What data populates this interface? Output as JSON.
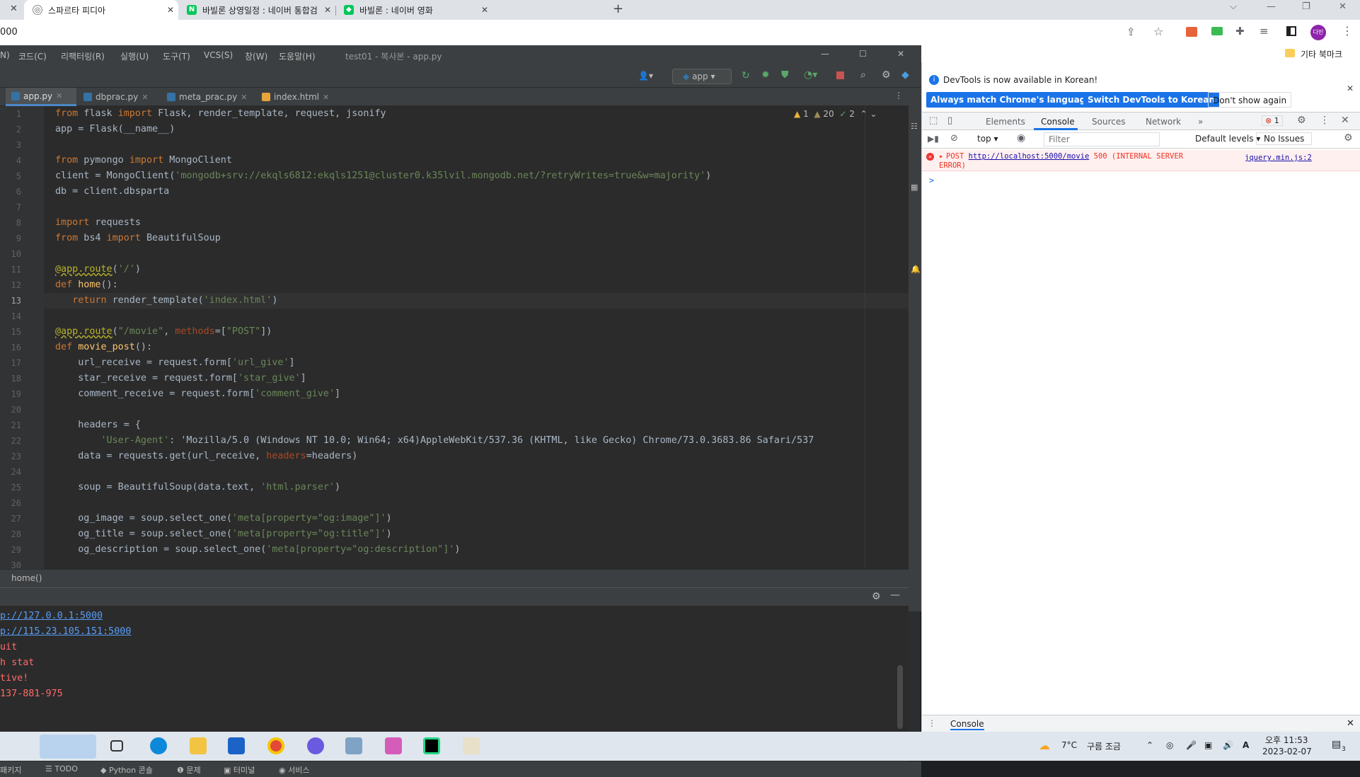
{
  "browser": {
    "tabs": [
      {
        "label": "스파르타 피디아",
        "active": true
      },
      {
        "label": "바빌론 상영일정 : 네이버 통합검",
        "active": false
      },
      {
        "label": "바빌론 : 네이버 영화",
        "active": false
      }
    ],
    "address": "000",
    "bookmarks_other": "기타 북마크",
    "profile": "다빈"
  },
  "ide": {
    "menus": [
      "N)",
      "코드(C)",
      "리팩터링(R)",
      "실행(U)",
      "도구(T)",
      "VCS(S)",
      "창(W)",
      "도움말(H)"
    ],
    "window_title": "test01 - 복사본 - app.py",
    "run_config": "app",
    "tabs": [
      {
        "label": "app.py",
        "active": true
      },
      {
        "label": "dbprac.py",
        "active": false
      },
      {
        "label": "meta_prac.py",
        "active": false
      },
      {
        "label": "index.html",
        "active": false
      }
    ],
    "inspections": {
      "warn_a": "1",
      "warn_b": "20",
      "ok": "2"
    },
    "current_line": 13,
    "line_numbers": [
      "1",
      "2",
      "3",
      "4",
      "5",
      "6",
      "7",
      "8",
      "9",
      "10",
      "11",
      "12",
      "13",
      "14",
      "15",
      "16",
      "17",
      "18",
      "19",
      "20",
      "21",
      "22",
      "23",
      "24",
      "25",
      "26",
      "27",
      "28",
      "29",
      "30"
    ],
    "code_lines": [
      "from flask import Flask, render_template, request, jsonify",
      "app = Flask(__name__)",
      "",
      "from pymongo import MongoClient",
      "client = MongoClient('mongodb+srv://ekqls6812:ekqls1251@cluster0.k35lvil.mongodb.net/?retryWrites=true&w=majority')",
      "db = client.dbsparta",
      "",
      "import requests",
      "from bs4 import BeautifulSoup",
      "",
      "@app.route('/')",
      "def home():",
      "   return render_template('index.html')",
      "",
      "@app.route(\"/movie\", methods=[\"POST\"])",
      "def movie_post():",
      "    url_receive = request.form['url_give']",
      "    star_receive = request.form['star_give']",
      "    comment_receive = request.form['comment_give']",
      "",
      "    headers = {",
      "        'User-Agent': 'Mozilla/5.0 (Windows NT 10.0; Win64; x64)AppleWebKit/537.36 (KHTML, like Gecko) Chrome/73.0.3683.86 Safari/537",
      "    data = requests.get(url_receive, headers=headers)",
      "",
      "    soup = BeautifulSoup(data.text, 'html.parser')",
      "",
      "    og_image = soup.select_one('meta[property=\"og:image\"]')",
      "    og_title = soup.select_one('meta[property=\"og:title\"]')",
      "    og_description = soup.select_one('meta[property=\"og:description\"]')",
      ""
    ],
    "breadcrumb": "home()",
    "run_output": [
      {
        "text": "p://127.0.0.1:5000",
        "kind": "link"
      },
      {
        "text": "p://115.23.105.151:5000",
        "kind": "link"
      },
      {
        "text": "uit",
        "kind": "red"
      },
      {
        "text": "h stat",
        "kind": "red"
      },
      {
        "text": "tive!",
        "kind": "red"
      },
      {
        "text": "137-881-975",
        "kind": "red"
      }
    ],
    "bottom_tools": [
      "패키지",
      "TODO",
      "Python 콘솔",
      "문제",
      "터미널",
      "서비스"
    ]
  },
  "devtools": {
    "notice": "DevTools is now available in Korean!",
    "btn_match": "Always match Chrome's language",
    "btn_switch": "Switch DevTools to Korean",
    "btn_dont": "Don't show again",
    "tabs": [
      "Elements",
      "Console",
      "Sources",
      "Network"
    ],
    "error_count": "1",
    "context": "top",
    "filter_placeholder": "Filter",
    "levels": "Default levels",
    "issues": "No Issues",
    "error_method": "POST",
    "error_url": "http://localhost:5000/movie",
    "error_status": "500 (INTERNAL SERVER",
    "error_status2": "ERROR)",
    "error_source": "jquery.min.js:2",
    "prompt": ">",
    "drawer_tab": "Console"
  },
  "taskbar": {
    "weather_temp": "7°C",
    "weather_text": "구름 조금",
    "time": "오후 11:53",
    "date": "2023-02-07",
    "ime": "A",
    "notif_count": "3"
  }
}
